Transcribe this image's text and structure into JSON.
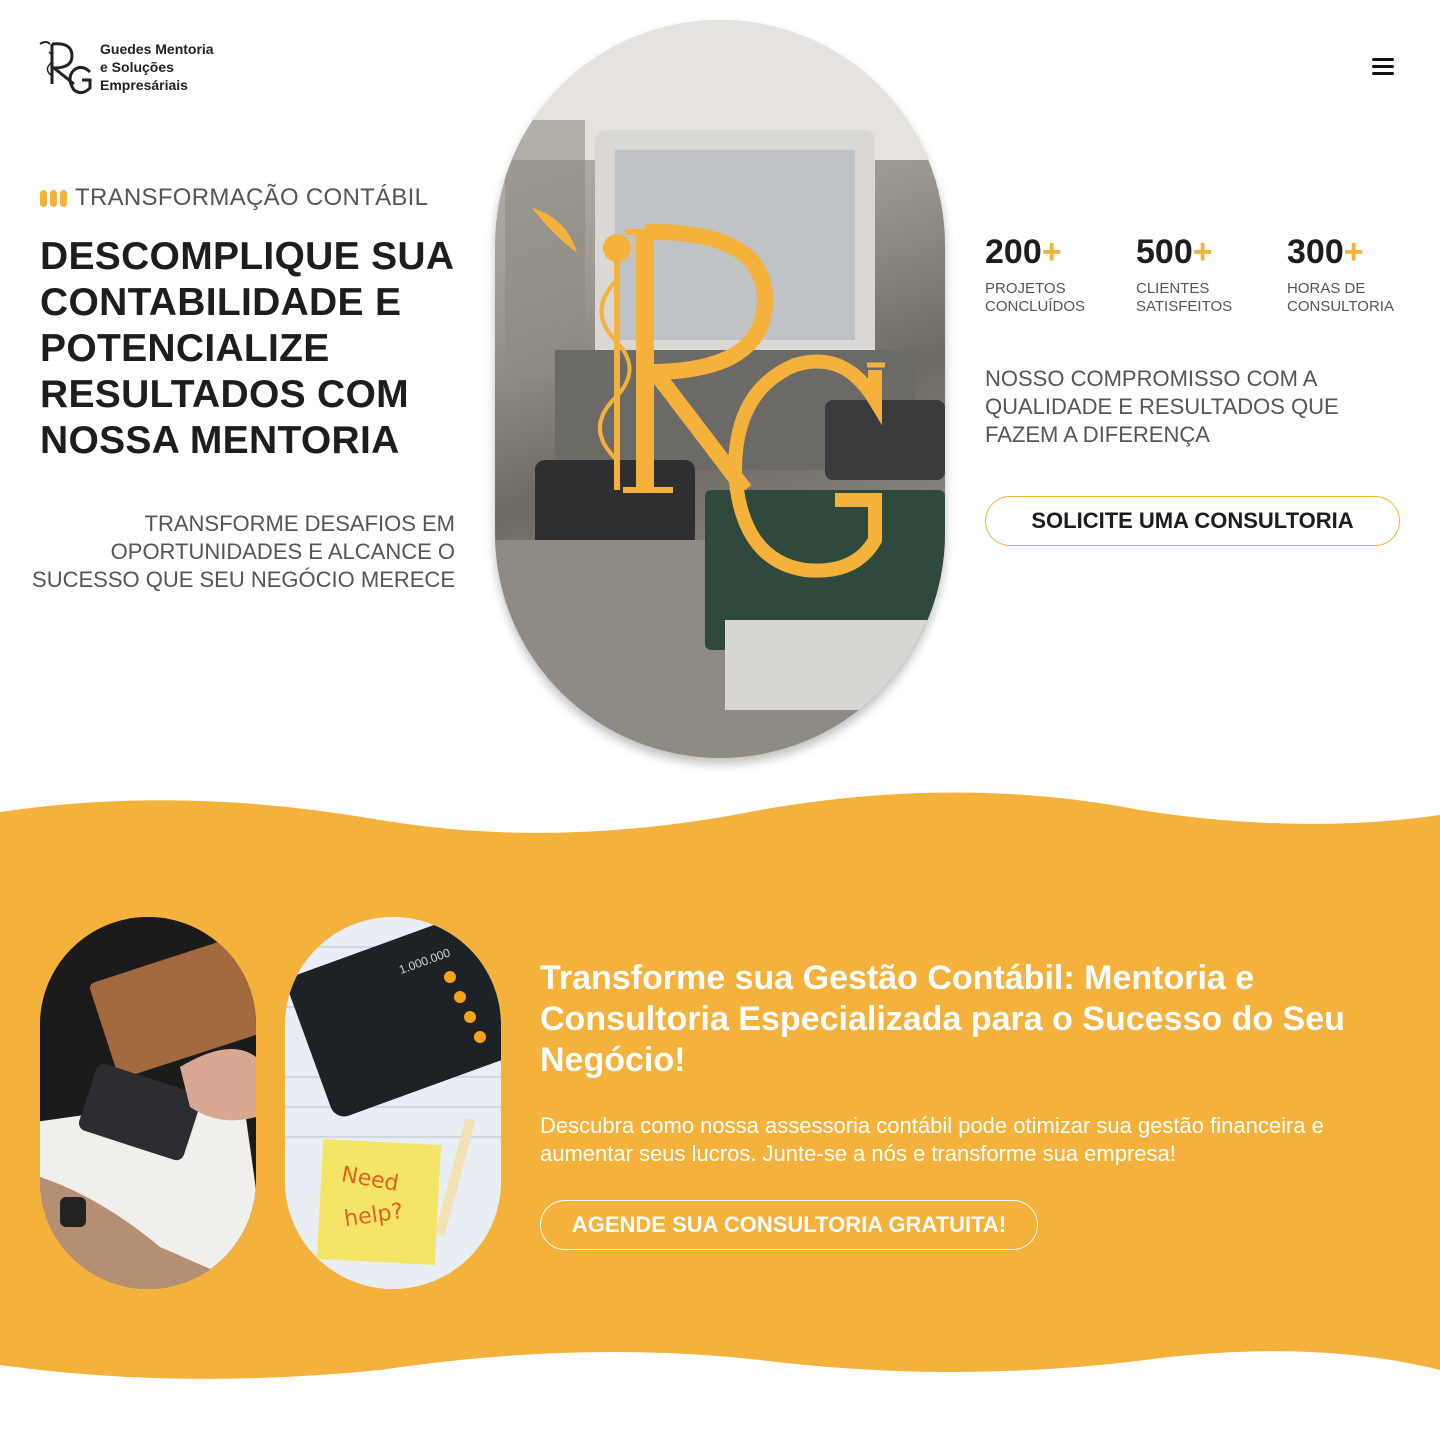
{
  "brand": {
    "name_line1": "Guedes Mentoria",
    "name_line2": "e Soluções",
    "name_line3": "Empresáriais",
    "logo_icon": "rg-monogram-icon",
    "accent_color": "#f4b23c"
  },
  "header": {
    "menu_icon": "hamburger-menu-icon"
  },
  "hero": {
    "eyebrow": "TRANSFORMAÇÃO CONTÁBIL",
    "title": "DESCOMPLIQUE SUA CONTABILIDADE E POTENCIALIZE RESULTADOS COM NOSSA MENTORIA",
    "subtitle": "TRANSFORME DESAFIOS EM OPORTUNIDADES E ALCANCE O SUCESSO QUE SEU NEGÓCIO MERECE",
    "stats": [
      {
        "value": "200",
        "suffix": "+",
        "label": "PROJETOS CONCLUÍDOS"
      },
      {
        "value": "500",
        "suffix": "+",
        "label": "CLIENTES SATISFEITOS"
      },
      {
        "value": "300",
        "suffix": "+",
        "label": "HORAS DE CONSULTORIA"
      }
    ],
    "commitment": "NOSSO COMPROMISSO COM A QUALIDADE E RESULTADOS QUE FAZEM A DIFERENÇA",
    "cta_label": "SOLICITE UMA CONSULTORIA"
  },
  "section": {
    "title": "Transforme sua Gestão Contábil: Mentoria e Consultoria Especializada para o Sucesso do Seu Negócio!",
    "text": "Descubra como nossa assessoria contábil pode otimizar sua gestão financeira e aumentar seus lucros. Junte-se a nós e transforme sua empresa!",
    "cta_label": "AGENDE SUA CONSULTORIA GRATUITA!",
    "background_color": "#f4b23c",
    "note_text_line1": "Need",
    "note_text_line2": "help?",
    "calculator_display": "1.000.000"
  }
}
